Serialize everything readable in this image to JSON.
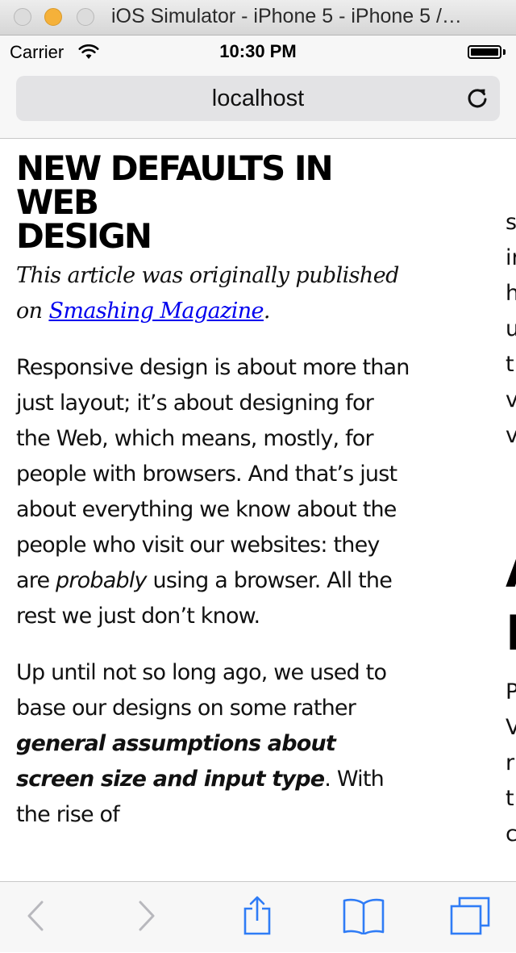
{
  "window": {
    "title": "iOS Simulator - iPhone 5 - iPhone 5 /…"
  },
  "status_bar": {
    "carrier": "Carrier",
    "time": "10:30 PM",
    "battery_level": 1.0
  },
  "address_bar": {
    "url": "localhost"
  },
  "article": {
    "title_line1": "NEW DEFAULTS IN WEB",
    "title_line2": "DESIGN",
    "intro_before": "This article was originally published on ",
    "intro_link": "Smashing Magazine",
    "intro_after": ".",
    "p1_before": "Responsive design is about more than just layout; it’s about designing for the Web, which means, mostly, for people with browsers. And that’s just about everything we know about the people who visit our websites: they are ",
    "p1_em": "probably",
    "p1_after": " using a browser. All the rest we just don’t know.",
    "p2_before": "Up until not so long ago, we used to base our designs on some rather ",
    "p2_strong": "general assumptions about screen size and input type",
    "p2_after": ". With the rise of"
  },
  "second_column": {
    "lines_top": [
      "s",
      "ir",
      "h",
      "u",
      "t",
      "v",
      "v"
    ],
    "heading_chars": [
      "A",
      "L"
    ],
    "lines_bottom": [
      "P",
      "V",
      "r",
      "t",
      "c"
    ]
  },
  "toolbar": {
    "icons": [
      "back-icon",
      "forward-icon",
      "share-icon",
      "bookmarks-icon",
      "tabs-icon"
    ]
  },
  "colors": {
    "link": "#0000ee",
    "toolbar_icon": "#2f7cf6",
    "toolbar_icon_disabled": "#b8b8bd",
    "minimize_button": "#f5b13a"
  }
}
